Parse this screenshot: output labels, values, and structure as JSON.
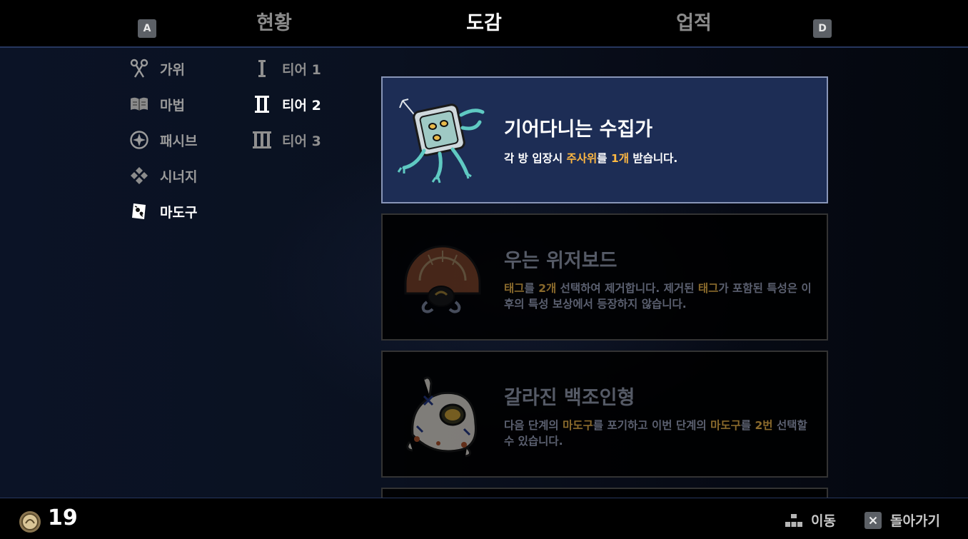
{
  "header": {
    "key_left": "A",
    "key_right": "D",
    "tabs": [
      {
        "label": "현황"
      },
      {
        "label": "도감"
      },
      {
        "label": "업적"
      }
    ]
  },
  "categories": [
    {
      "label": "가위",
      "icon": "scissors-icon"
    },
    {
      "label": "마법",
      "icon": "spellbook-icon"
    },
    {
      "label": "패시브",
      "icon": "compass-icon"
    },
    {
      "label": "시너지",
      "icon": "synergy-diamond-icon"
    },
    {
      "label": "마도구",
      "icon": "artifact-card-icon"
    }
  ],
  "tiers": [
    {
      "label": "티어 1",
      "icon": "tier-1-icon"
    },
    {
      "label": "티어 2",
      "icon": "tier-2-icon"
    },
    {
      "label": "티어 3",
      "icon": "tier-3-icon"
    }
  ],
  "items": [
    {
      "title": "기어다니는 수집가",
      "art": "crawling-collector-art",
      "desc": [
        {
          "t": "각 방 입장시 "
        },
        {
          "t": "주사위",
          "hl": true
        },
        {
          "t": "를 "
        },
        {
          "t": "1개",
          "hl": true
        },
        {
          "t": " 받습니다."
        }
      ]
    },
    {
      "title": "우는 위저보드",
      "art": "weeping-ouija-board-art",
      "desc": [
        {
          "t": "태그",
          "hl": true
        },
        {
          "t": "를 "
        },
        {
          "t": "2개",
          "hl": true
        },
        {
          "t": " 선택하여 제거합니다. 제거된 "
        },
        {
          "t": "태그",
          "hl": true
        },
        {
          "t": "가 포함된 특성은 이후의 특성 보상에서 등장하지 않습니다."
        }
      ]
    },
    {
      "title": "갈라진 백조인형",
      "art": "cracked-swan-doll-art",
      "desc": [
        {
          "t": "다음 단계의 "
        },
        {
          "t": "마도구",
          "hl": true
        },
        {
          "t": "를 포기하고 이번 단계의 "
        },
        {
          "t": "마도구",
          "hl": true
        },
        {
          "t": "를 "
        },
        {
          "t": "2번",
          "hl": true
        },
        {
          "t": " 선택할 수 있습니다."
        }
      ]
    }
  ],
  "footer": {
    "coin_count": "19",
    "hint_move": "이동",
    "hint_back": "돌아가기"
  }
}
